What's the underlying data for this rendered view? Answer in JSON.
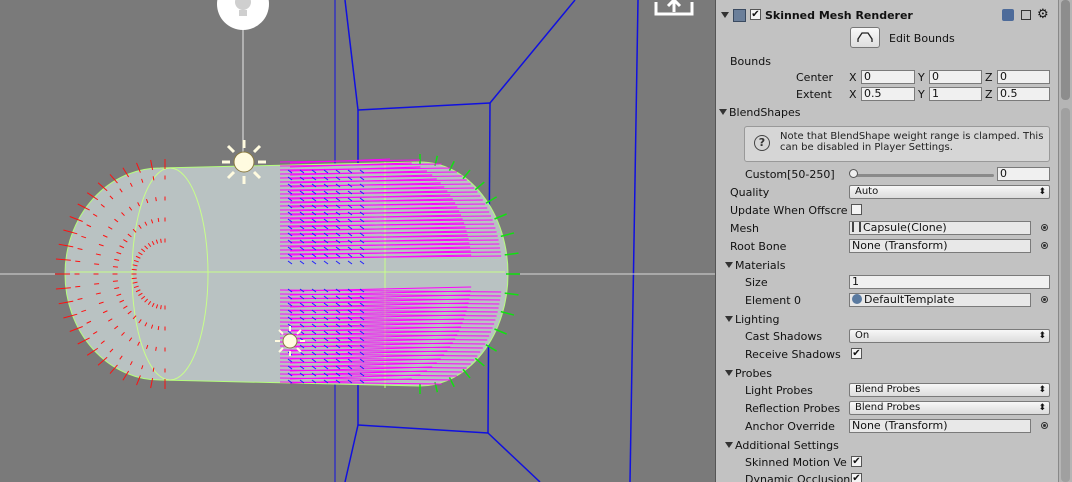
{
  "component": {
    "title": "Skinned Mesh Renderer",
    "edit_bounds_label": "Edit Bounds",
    "enabled": true
  },
  "bounds": {
    "label": "Bounds",
    "center": {
      "label": "Center",
      "x": "0",
      "y": "0",
      "z": "0"
    },
    "extent": {
      "label": "Extent",
      "x": "0.5",
      "y": "1",
      "z": "0.5"
    },
    "axis_x": "X",
    "axis_y": "Y",
    "axis_z": "Z"
  },
  "blendshapes": {
    "label": "BlendShapes",
    "help_text": "Note that BlendShape weight range is clamped. This can be disabled in Player Settings.",
    "custom_label": "Custom[50-250]",
    "custom_value": "0",
    "custom_level": 0
  },
  "quality": {
    "label": "Quality",
    "value": "Auto"
  },
  "update_offscreen": {
    "label": "Update When Offscre",
    "checked": false
  },
  "mesh": {
    "label": "Mesh",
    "value": "Capsule(Clone)"
  },
  "root_bone": {
    "label": "Root Bone",
    "value": "None (Transform)"
  },
  "materials": {
    "label": "Materials",
    "size_label": "Size",
    "size_value": "1",
    "element0_label": "Element 0",
    "element0_value": "DefaultTemplate"
  },
  "lighting": {
    "label": "Lighting",
    "cast_shadows_label": "Cast Shadows",
    "cast_shadows_value": "On",
    "receive_shadows_label": "Receive Shadows",
    "receive_shadows_checked": true
  },
  "probes": {
    "label": "Probes",
    "light_probes_label": "Light Probes",
    "light_probes_value": "Blend Probes",
    "reflection_probes_label": "Reflection Probes",
    "reflection_probes_value": "Blend Probes",
    "anchor_override_label": "Anchor Override",
    "anchor_override_value": "None (Transform)"
  },
  "additional": {
    "label": "Additional Settings",
    "skinned_motion_label": "Skinned Motion Ve",
    "dynamic_occlusion_label": "Dynamic Occlusion"
  },
  "icons": {
    "checkmark": "✔",
    "help": "?",
    "caret": "⬍"
  },
  "colors": {
    "normals": "#ff00ff",
    "tangents": "#ff0000",
    "binormals": "#00e000",
    "wire": "#0000ff"
  }
}
